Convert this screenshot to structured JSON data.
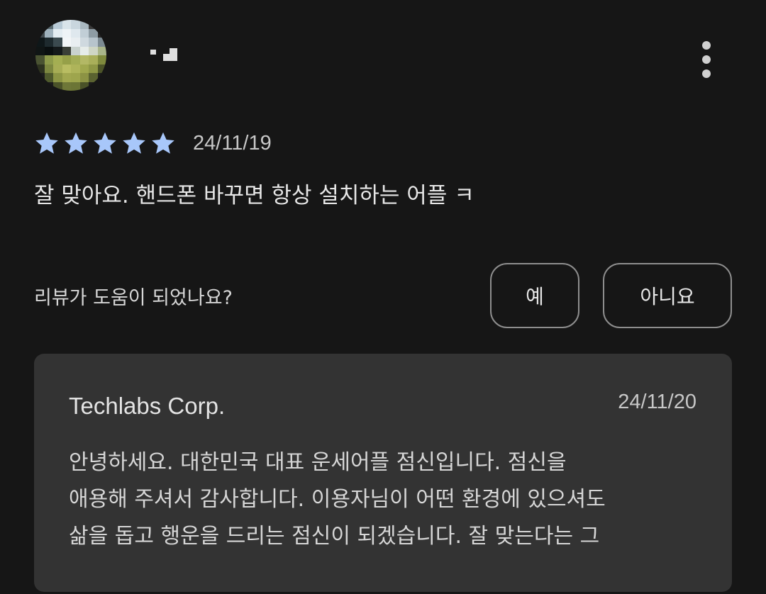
{
  "reviewer": {
    "avatar_icon": "user-avatar-pixelated",
    "name": "",
    "more_icon": "more-vertical-icon"
  },
  "review": {
    "rating": 5,
    "max_rating": 5,
    "star_color": "#a8c7fa",
    "date": "24/11/19",
    "text": "잘 맞아요. 핸드폰 바꾸면 항상 설치하는 어플 ㅋ"
  },
  "helpful": {
    "question": "리뷰가 도움이 되었나요?",
    "yes_label": "예",
    "no_label": "아니요"
  },
  "developer_reply": {
    "name": "Techlabs Corp.",
    "date": "24/11/20",
    "lines": [
      "안녕하세요. 대한민국 대표 운세어플 점신입니다. 점신을",
      "애용해 주셔서 감사합니다. 이용자님이 어떤 환경에 있으셔도",
      "삶을 돕고 행운을 드리는 점신이 되겠습니다. 잘 맞는다는 그"
    ]
  },
  "colors": {
    "background": "#161616",
    "card": "#333333",
    "star": "#a8c7fa"
  }
}
